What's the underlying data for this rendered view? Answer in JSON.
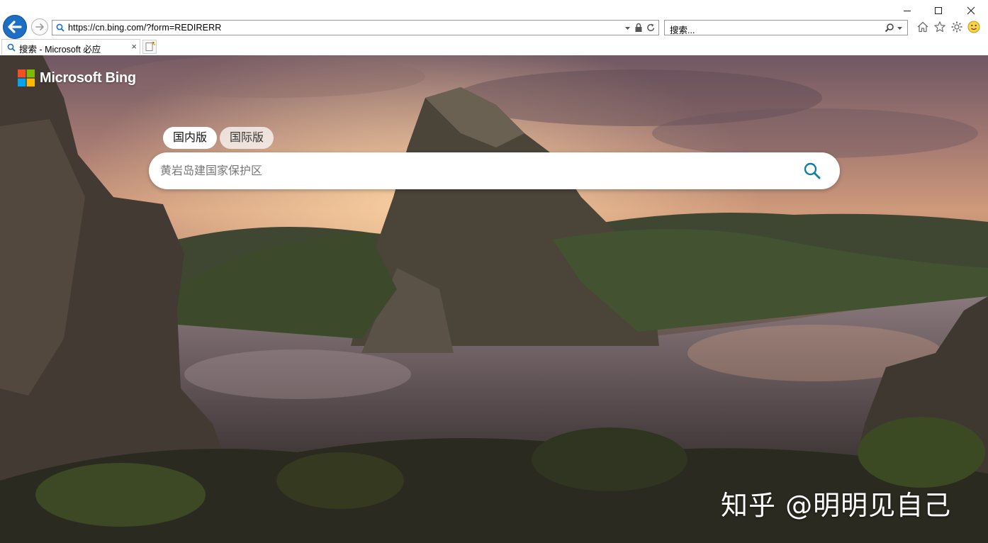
{
  "browser": {
    "address_url": "https://cn.bing.com/?form=REDIRERR",
    "search_placeholder": "搜索...",
    "tab_title": "搜索 - Microsoft 必应",
    "tab_close": "×"
  },
  "page": {
    "logo_text": "Microsoft Bing",
    "scope_tabs": [
      {
        "label": "国内版",
        "active": true
      },
      {
        "label": "国际版",
        "active": false
      }
    ],
    "search_placeholder": "黄岩岛建国家保护区",
    "watermark": "知乎 @明明见自己"
  },
  "colors": {
    "accent_blue": "#1d6fc4",
    "search_icon": "#0f7ea6"
  }
}
